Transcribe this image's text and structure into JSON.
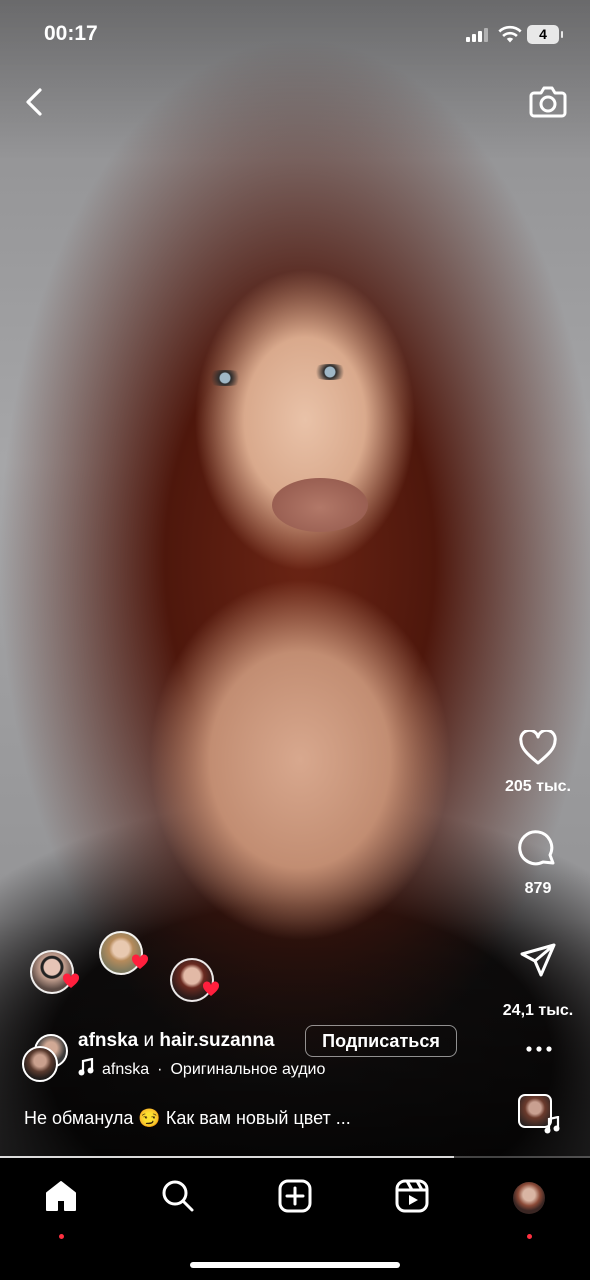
{
  "status_bar": {
    "time": "00:17",
    "battery": "4"
  },
  "actions": {
    "likes": "205 тыс.",
    "comments": "879",
    "shares": "24,1 тыс."
  },
  "post": {
    "author_1": "afnska",
    "conjunction": "и",
    "author_2": "hair.suzanna",
    "follow_label": "Подписаться",
    "audio_author": "afnska",
    "audio_separator": "·",
    "audio_title": "Оригинальное аудио",
    "caption_start": "Не обманула",
    "caption_emoji": "😏",
    "caption_end": "Как вам новый цвет ..."
  },
  "progress": {
    "played_fraction": 0.77
  },
  "colors": {
    "notification_dot": "#ff3040",
    "heart_badge": "#ff1f3d"
  },
  "icons": [
    "back-icon",
    "camera-icon",
    "heart-icon",
    "comment-icon",
    "send-icon",
    "more-icon",
    "music-note-icon",
    "home-icon",
    "search-icon",
    "create-icon",
    "reels-icon"
  ]
}
